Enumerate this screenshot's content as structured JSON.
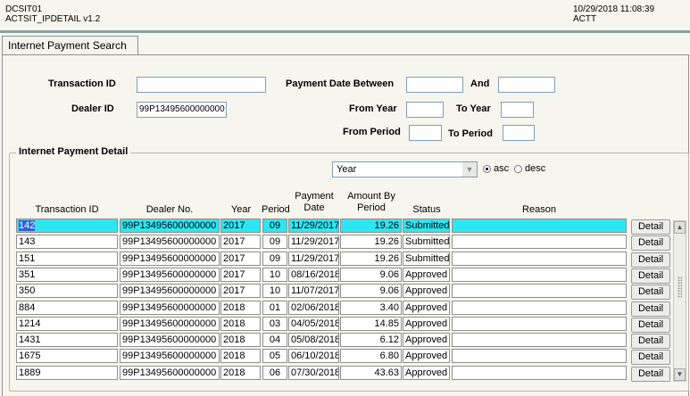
{
  "header": {
    "form_id": "DCSIT01",
    "form_name": "ACTSIT_IPDETAIL  v1.2",
    "timestamp": "10/29/2018 11:08:39",
    "user": "ACTT"
  },
  "tab": {
    "label": "Internet Payment Search"
  },
  "search": {
    "transaction_id_label": "Transaction ID",
    "transaction_id_value": "",
    "dealer_id_label": "Dealer ID",
    "dealer_id_value": "99P13495600000000",
    "payment_date_between_label": "Payment Date Between",
    "payment_date_from_value": "",
    "and_label": "And",
    "payment_date_to_value": "",
    "from_year_label": "From Year",
    "from_year_value": "",
    "to_year_label": "To Year",
    "to_year_value": "",
    "from_period_label": "From Period",
    "from_period_value": "",
    "to_period_label": "To Period",
    "to_period_value": ""
  },
  "detail": {
    "title": "Internet Payment Detail",
    "sort_field": "Year",
    "sort_asc_label": "asc",
    "sort_desc_label": "desc",
    "sort_selected": "asc",
    "columns": {
      "transaction_id": "Transaction ID",
      "dealer_no": "Dealer No.",
      "year": "Year",
      "period": "Period",
      "payment_date": "Payment Date",
      "amount_by_period": "Amount By Period",
      "status": "Status",
      "reason": "Reason"
    },
    "detail_button_label": "Detail",
    "rows": [
      {
        "txn": "142",
        "dealer": "99P13495600000000",
        "year": "2017",
        "period": "09",
        "date": "11/29/2017",
        "amount": "19.26",
        "status": "Submitted",
        "reason": ""
      },
      {
        "txn": "143",
        "dealer": "99P13495600000000",
        "year": "2017",
        "period": "09",
        "date": "11/29/2017",
        "amount": "19.26",
        "status": "Submitted",
        "reason": ""
      },
      {
        "txn": "151",
        "dealer": "99P13495600000000",
        "year": "2017",
        "period": "09",
        "date": "11/29/2017",
        "amount": "19.26",
        "status": "Submitted",
        "reason": ""
      },
      {
        "txn": "351",
        "dealer": "99P13495600000000",
        "year": "2017",
        "period": "10",
        "date": "08/16/2018",
        "amount": "9.06",
        "status": "Approved",
        "reason": ""
      },
      {
        "txn": "350",
        "dealer": "99P13495600000000",
        "year": "2017",
        "period": "10",
        "date": "11/07/2017",
        "amount": "9.06",
        "status": "Approved",
        "reason": ""
      },
      {
        "txn": "884",
        "dealer": "99P13495600000000",
        "year": "2018",
        "period": "01",
        "date": "02/06/2018",
        "amount": "3.40",
        "status": "Approved",
        "reason": ""
      },
      {
        "txn": "1214",
        "dealer": "99P13495600000000",
        "year": "2018",
        "period": "03",
        "date": "04/05/2018",
        "amount": "14.85",
        "status": "Approved",
        "reason": ""
      },
      {
        "txn": "1431",
        "dealer": "99P13495600000000",
        "year": "2018",
        "period": "04",
        "date": "05/08/2018",
        "amount": "6.12",
        "status": "Approved",
        "reason": ""
      },
      {
        "txn": "1675",
        "dealer": "99P13495600000000",
        "year": "2018",
        "period": "05",
        "date": "06/10/2018",
        "amount": "6.80",
        "status": "Approved",
        "reason": ""
      },
      {
        "txn": "1889",
        "dealer": "99P13495600000000",
        "year": "2018",
        "period": "06",
        "date": "07/30/2018",
        "amount": "43.63",
        "status": "Approved",
        "reason": ""
      }
    ]
  },
  "colors": {
    "selected_row": "#2ee6f2",
    "selected_text_highlight": "#2b63d8",
    "header_rule": "#8aa0a4"
  }
}
